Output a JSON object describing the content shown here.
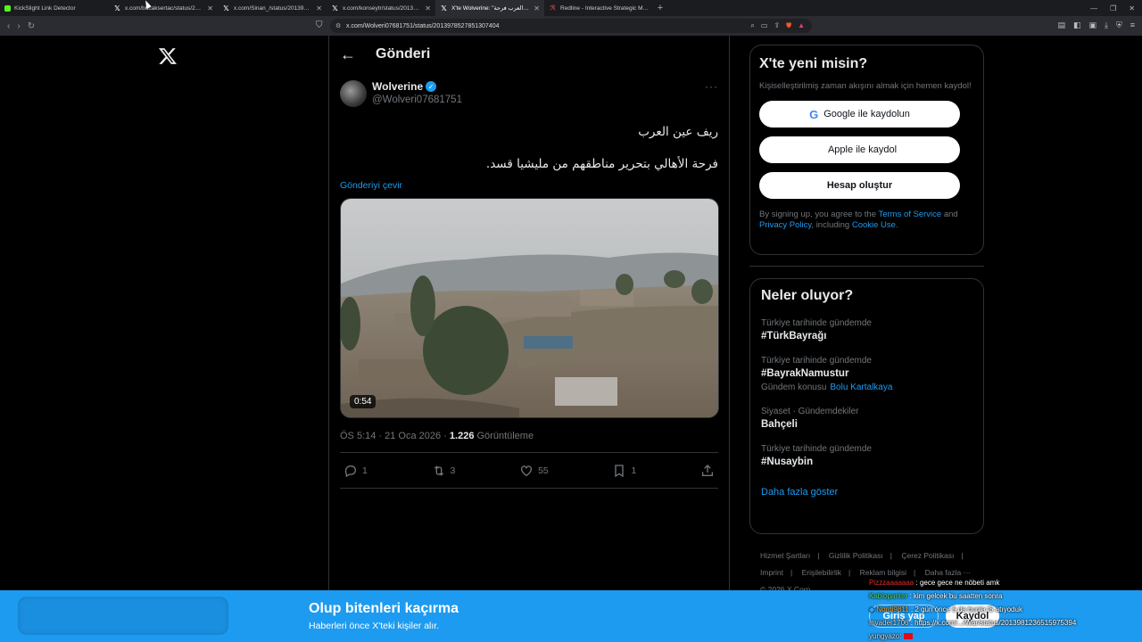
{
  "browser": {
    "tabs": [
      {
        "title": "KickSlight Link Detector",
        "icon": "kick-icon",
        "active": false
      },
      {
        "title": "x.com/bucaksertac/status/2013...",
        "icon": "x-icon",
        "active": false
      },
      {
        "title": "x.com/Sinan_/status/201397986205...",
        "icon": "x-icon",
        "active": false
      },
      {
        "title": "x.com/konseytr/status/20139451423...",
        "icon": "x-icon",
        "active": false
      },
      {
        "title": "X'te Wolverine: \"ريف عين العرب فرحة...\"",
        "icon": "x-icon",
        "active": true
      },
      {
        "title": "Redline - Interactive Strategic Map",
        "icon": "redline-icon",
        "active": false
      }
    ],
    "url": "x.com/Wolveri07681751/status/2013978527851307404"
  },
  "page": {
    "title": "Gönderi",
    "post": {
      "author_name": "Wolverine",
      "author_handle": "@Wolveri07681751",
      "text_line1": "ريف عين العرب",
      "text_line2": "فرحة الأهالي بتحرير مناطقهم من مليشيا قسد.",
      "translate_label": "Gönderiyi çevir",
      "video_duration": "0:54",
      "timestamp": "ÖS 5:14 · 21 Oca 2026 · ",
      "views_count": "1.226",
      "views_label": " Görüntüleme",
      "replies": "1",
      "reposts": "3",
      "likes": "55",
      "bookmarks": "1"
    }
  },
  "signup_card": {
    "title": "X'te yeni misin?",
    "subtitle": "Kişiselleştirilmiş zaman akışını almak için hemen kaydol!",
    "google_btn": "Google ile kaydolun",
    "apple_btn": "Apple ile kaydol",
    "create_btn": "Hesap oluştur",
    "terms_pre": "By signing up, you agree to the ",
    "terms_link": "Terms of Service",
    "terms_mid": " and ",
    "privacy_link": "Privacy Policy",
    "terms_mid2": ", including ",
    "cookie_link": "Cookie Use",
    "terms_end": "."
  },
  "trends": {
    "title": "Neler oluyor?",
    "items": [
      {
        "context": "Türkiye tarihinde gündemde",
        "tag": "#TürkBayrağı"
      },
      {
        "context": "Türkiye tarihinde gündemde",
        "tag": "#BayrakNamustur",
        "topic_label": "Gündem konusu",
        "topic_link": "Bolu Kartalkaya"
      },
      {
        "context": "Siyaset · Gündemdekiler",
        "tag": "Bahçeli"
      },
      {
        "context": "Türkiye tarihinde gündemde",
        "tag": "#Nusaybin"
      }
    ],
    "show_more": "Daha fazla göster"
  },
  "footer": {
    "links": [
      "Hizmet Şartları",
      "Gizlilik Politikası",
      "Çerez Politikası",
      "Imprint",
      "Erişilebilirlik",
      "Reklam bilgisi",
      "Daha fazla ···"
    ],
    "copyright": "© 2026 X Corp."
  },
  "banner": {
    "title": "Olup bitenleri kaçırma",
    "subtitle": "Haberleri önce X'teki kişiler alır.",
    "login": "Giriş yap",
    "signup": "Kaydol"
  },
  "chat": [
    {
      "user": "Pizzzaaaaaaa",
      "msg": ": gece gece ne nöbeti amk"
    },
    {
      "user": "Kablopanter",
      "msg": ": kim gelcek bu saatten sonra"
    },
    {
      "user": "Nordi9811",
      "msg": ": 2 gün önce 5 da bunla f5 atıyoduk"
    },
    {
      "user": "Invader1706",
      "msg": ": https://x.com/.../War/status/2013981236515975394"
    },
    {
      "user": "yungyazo",
      "msg": ":"
    }
  ],
  "colors": {
    "accent": "#1d9bf0",
    "background": "#000000",
    "border": "#2f3336",
    "muted_text": "#71767b"
  }
}
